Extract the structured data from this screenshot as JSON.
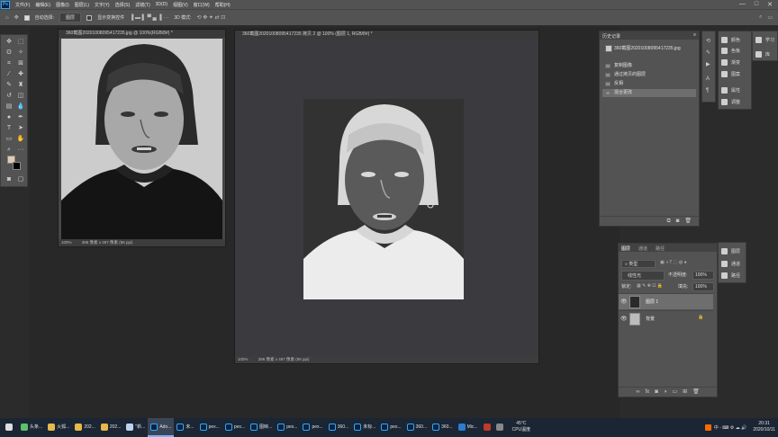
{
  "app": {
    "name": "Ps",
    "window_controls": [
      "—",
      "□",
      "✕"
    ]
  },
  "menu": [
    "文件(F)",
    "编辑(E)",
    "图像(I)",
    "图层(L)",
    "文字(Y)",
    "选择(S)",
    "滤镜(T)",
    "3D(D)",
    "视图(V)",
    "窗口(W)",
    "帮助(H)"
  ],
  "options_bar": {
    "auto_select_label": "自动选择:",
    "auto_select_value": "图层",
    "transform_label": "显示变换控件",
    "mode_label": "3D 模式:"
  },
  "documents": [
    {
      "title": "360截图20201008095417235.jpg @ 100%(RGB/8#) *",
      "zoom": "100%",
      "info": "396 像素 x 497 像素 (96 ppi)"
    },
    {
      "title": "360截图20201008095417235 拷贝 2 @ 100% (图层 1, RGB/8#) *",
      "zoom": "100%",
      "info": "396 像素 x 497 像素 (96 ppi)"
    }
  ],
  "history_panel": {
    "tab": "历史记录",
    "snapshot": "360截图20201008095417235.jpg",
    "items": [
      "复制图像",
      "通过拷贝的图层",
      "反相",
      "混合更改"
    ]
  },
  "layers_panel": {
    "tabs": [
      "图层",
      "通道",
      "路径"
    ],
    "filter_label": "类型",
    "blend_mode": "线性光",
    "opacity_label": "不透明度:",
    "opacity_value": "100%",
    "lock_label": "锁定:",
    "fill_label": "填充:",
    "fill_value": "100%",
    "layers": [
      {
        "name": "图层 1",
        "selected": true
      },
      {
        "name": "背景",
        "selected": false
      }
    ]
  },
  "right_strip": {
    "group1": [
      "颜色",
      "色板",
      "渐变",
      "图案"
    ],
    "group2": [
      "属性",
      "调整"
    ],
    "group3": [
      "学习",
      "库"
    ],
    "group4": [
      "图层",
      "通道",
      "路径"
    ]
  },
  "taskbar": {
    "items": [
      "头条...",
      "火狐...",
      "202...",
      "202...",
      "\"新...",
      "Ado...",
      "未...",
      "pex...",
      "pex...",
      "图映...",
      "pex...",
      "pex...",
      "360...",
      "未标...",
      "pex...",
      "360...",
      "360...",
      "Mic..."
    ],
    "active_index": 5,
    "temp": "45°C",
    "cpu_label": "CPU温度",
    "clock_time": "20:31",
    "clock_date": "2020/10/11"
  },
  "colors": {
    "ps_blue": "#31a8ff",
    "panel_bg": "#535353",
    "canvas_bg": "#282828",
    "foreground_swatch": "#e3cbb0",
    "taskbar_bg": "#1b2533"
  }
}
